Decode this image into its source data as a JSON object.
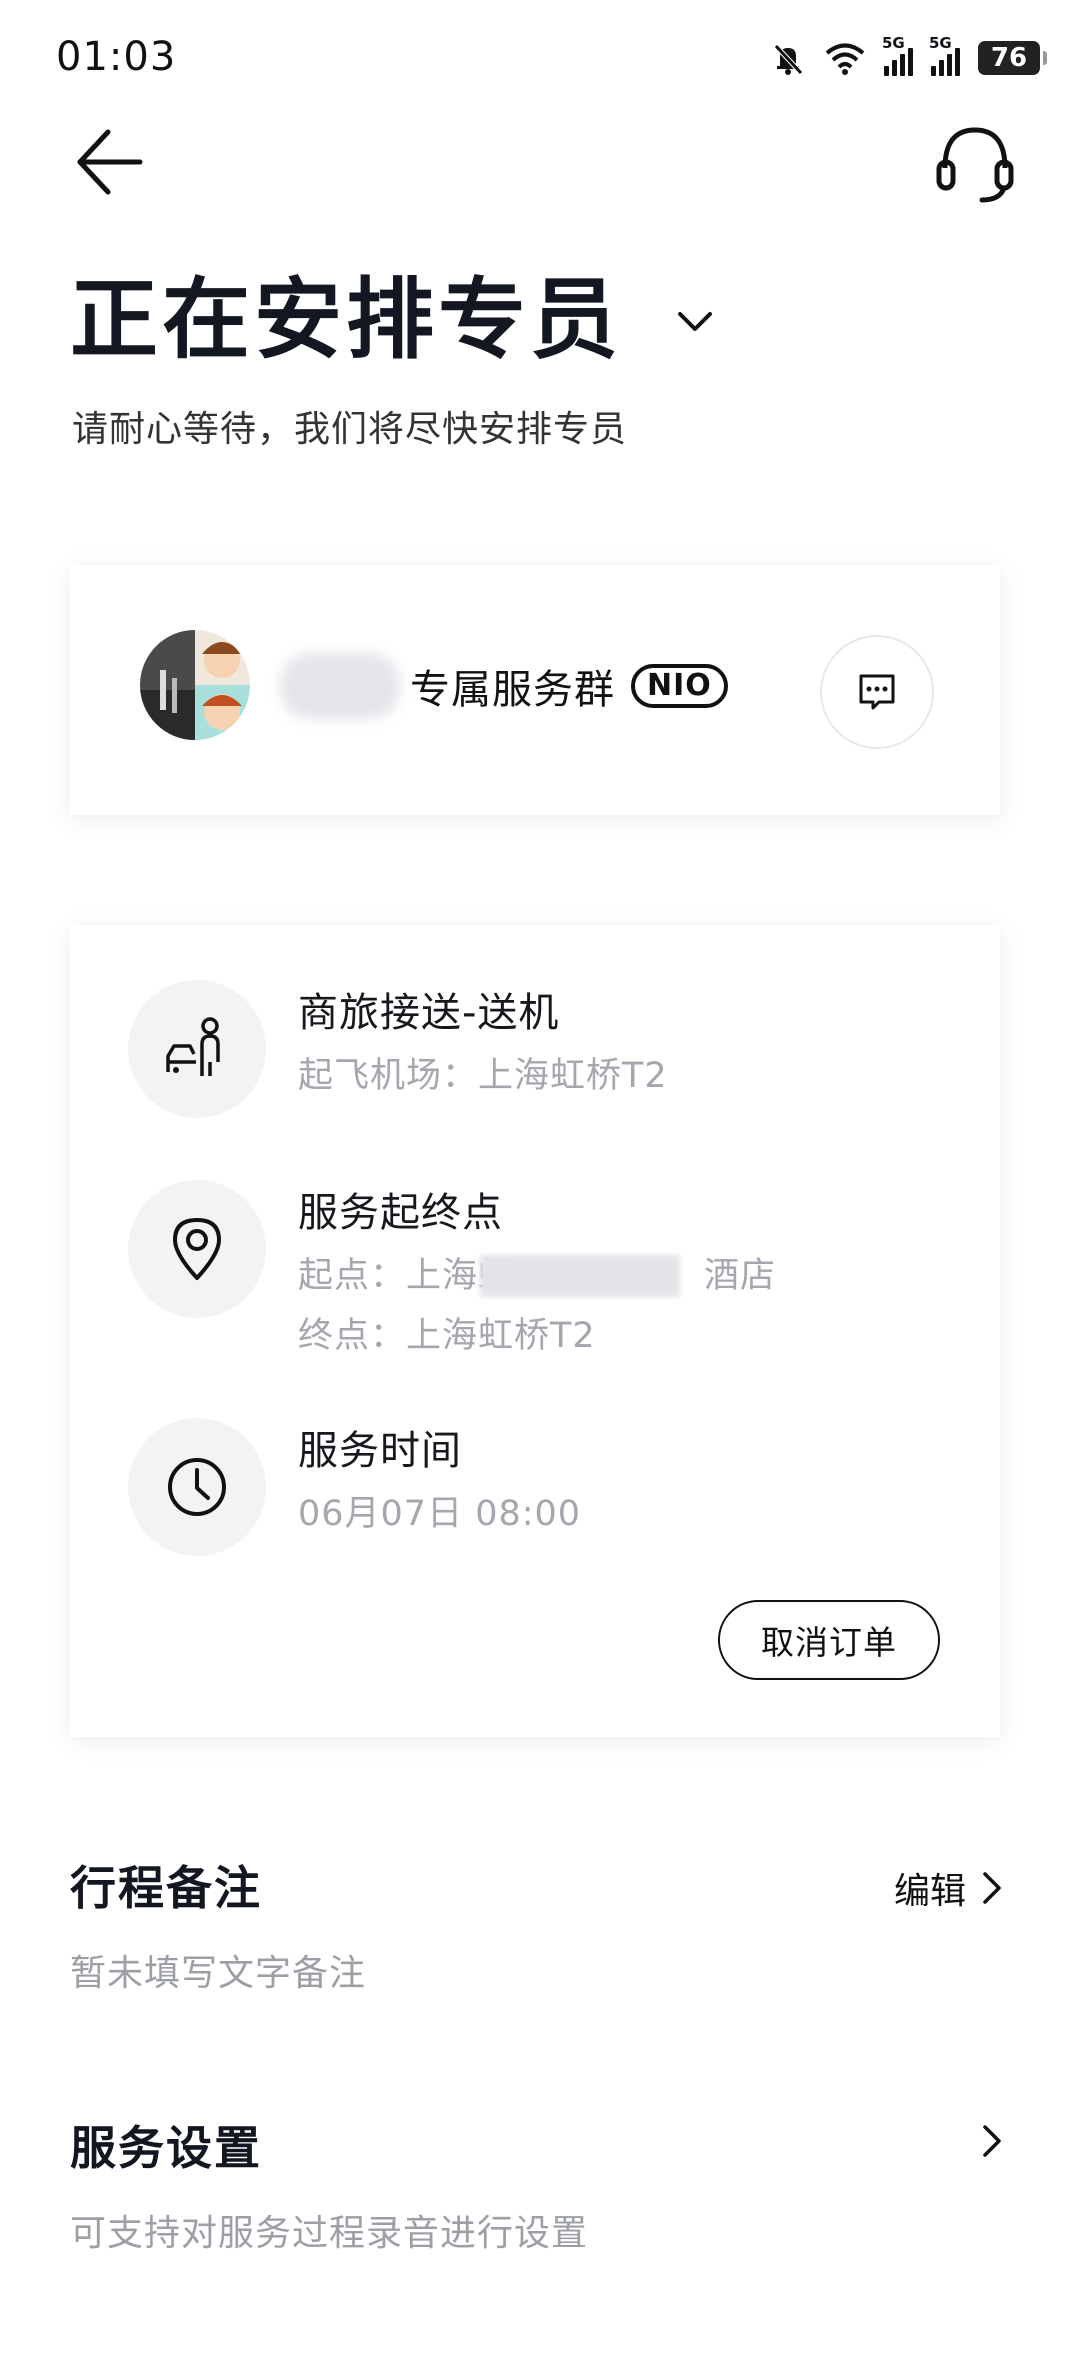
{
  "status_bar": {
    "time": "01:03",
    "signal1_label": "5G",
    "signal2_label": "5G",
    "battery": "76"
  },
  "header": {
    "title": "正在安排专员",
    "subtitle": "请耐心等待，我们将尽快安排专员"
  },
  "group": {
    "name": "专属服务群",
    "badge": "NIO"
  },
  "service": {
    "type_title": "商旅接送-送机",
    "type_sub": "起飞机场：上海虹桥T2",
    "route_title": "服务起终点",
    "route_start_prefix": "起点：上海虹",
    "route_start_suffix": "酒店",
    "route_end": "终点：上海虹桥T2",
    "time_title": "服务时间",
    "time_value": "06月07日 08:00",
    "cancel_label": "取消订单"
  },
  "notes": {
    "title": "行程备注",
    "edit_label": "编辑",
    "sub": "暂未填写文字备注"
  },
  "settings": {
    "title": "服务设置",
    "sub": "可支持对服务过程录音进行设置"
  },
  "colors": {
    "title": "#131722",
    "secondary_text": "#a4a7ad",
    "icon_bg": "#f2f3f5"
  }
}
